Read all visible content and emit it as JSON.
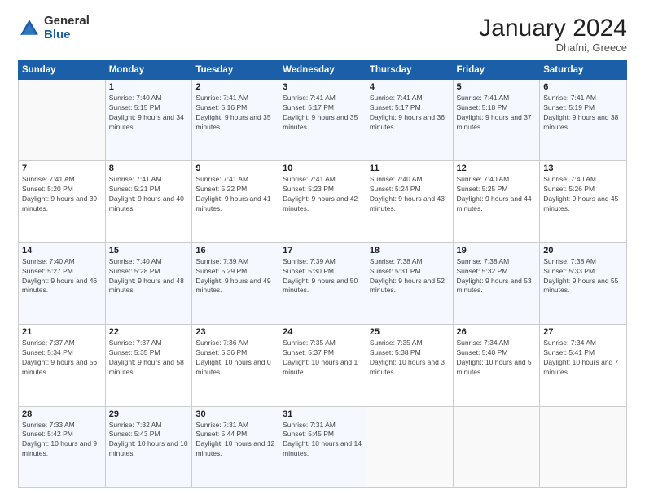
{
  "logo": {
    "general": "General",
    "blue": "Blue"
  },
  "header": {
    "month": "January 2024",
    "location": "Dhafni, Greece"
  },
  "weekdays": [
    "Sunday",
    "Monday",
    "Tuesday",
    "Wednesday",
    "Thursday",
    "Friday",
    "Saturday"
  ],
  "weeks": [
    [
      {
        "day": "",
        "sunrise": "",
        "sunset": "",
        "daylight": ""
      },
      {
        "day": "1",
        "sunrise": "7:40 AM",
        "sunset": "5:15 PM",
        "daylight": "9 hours and 34 minutes."
      },
      {
        "day": "2",
        "sunrise": "7:41 AM",
        "sunset": "5:16 PM",
        "daylight": "9 hours and 35 minutes."
      },
      {
        "day": "3",
        "sunrise": "7:41 AM",
        "sunset": "5:17 PM",
        "daylight": "9 hours and 35 minutes."
      },
      {
        "day": "4",
        "sunrise": "7:41 AM",
        "sunset": "5:17 PM",
        "daylight": "9 hours and 36 minutes."
      },
      {
        "day": "5",
        "sunrise": "7:41 AM",
        "sunset": "5:18 PM",
        "daylight": "9 hours and 37 minutes."
      },
      {
        "day": "6",
        "sunrise": "7:41 AM",
        "sunset": "5:19 PM",
        "daylight": "9 hours and 38 minutes."
      }
    ],
    [
      {
        "day": "7",
        "sunrise": "7:41 AM",
        "sunset": "5:20 PM",
        "daylight": "9 hours and 39 minutes."
      },
      {
        "day": "8",
        "sunrise": "7:41 AM",
        "sunset": "5:21 PM",
        "daylight": "9 hours and 40 minutes."
      },
      {
        "day": "9",
        "sunrise": "7:41 AM",
        "sunset": "5:22 PM",
        "daylight": "9 hours and 41 minutes."
      },
      {
        "day": "10",
        "sunrise": "7:41 AM",
        "sunset": "5:23 PM",
        "daylight": "9 hours and 42 minutes."
      },
      {
        "day": "11",
        "sunrise": "7:40 AM",
        "sunset": "5:24 PM",
        "daylight": "9 hours and 43 minutes."
      },
      {
        "day": "12",
        "sunrise": "7:40 AM",
        "sunset": "5:25 PM",
        "daylight": "9 hours and 44 minutes."
      },
      {
        "day": "13",
        "sunrise": "7:40 AM",
        "sunset": "5:26 PM",
        "daylight": "9 hours and 45 minutes."
      }
    ],
    [
      {
        "day": "14",
        "sunrise": "7:40 AM",
        "sunset": "5:27 PM",
        "daylight": "9 hours and 46 minutes."
      },
      {
        "day": "15",
        "sunrise": "7:40 AM",
        "sunset": "5:28 PM",
        "daylight": "9 hours and 48 minutes."
      },
      {
        "day": "16",
        "sunrise": "7:39 AM",
        "sunset": "5:29 PM",
        "daylight": "9 hours and 49 minutes."
      },
      {
        "day": "17",
        "sunrise": "7:39 AM",
        "sunset": "5:30 PM",
        "daylight": "9 hours and 50 minutes."
      },
      {
        "day": "18",
        "sunrise": "7:38 AM",
        "sunset": "5:31 PM",
        "daylight": "9 hours and 52 minutes."
      },
      {
        "day": "19",
        "sunrise": "7:38 AM",
        "sunset": "5:32 PM",
        "daylight": "9 hours and 53 minutes."
      },
      {
        "day": "20",
        "sunrise": "7:38 AM",
        "sunset": "5:33 PM",
        "daylight": "9 hours and 55 minutes."
      }
    ],
    [
      {
        "day": "21",
        "sunrise": "7:37 AM",
        "sunset": "5:34 PM",
        "daylight": "9 hours and 56 minutes."
      },
      {
        "day": "22",
        "sunrise": "7:37 AM",
        "sunset": "5:35 PM",
        "daylight": "9 hours and 58 minutes."
      },
      {
        "day": "23",
        "sunrise": "7:36 AM",
        "sunset": "5:36 PM",
        "daylight": "10 hours and 0 minutes."
      },
      {
        "day": "24",
        "sunrise": "7:35 AM",
        "sunset": "5:37 PM",
        "daylight": "10 hours and 1 minute."
      },
      {
        "day": "25",
        "sunrise": "7:35 AM",
        "sunset": "5:38 PM",
        "daylight": "10 hours and 3 minutes."
      },
      {
        "day": "26",
        "sunrise": "7:34 AM",
        "sunset": "5:40 PM",
        "daylight": "10 hours and 5 minutes."
      },
      {
        "day": "27",
        "sunrise": "7:34 AM",
        "sunset": "5:41 PM",
        "daylight": "10 hours and 7 minutes."
      }
    ],
    [
      {
        "day": "28",
        "sunrise": "7:33 AM",
        "sunset": "5:42 PM",
        "daylight": "10 hours and 9 minutes."
      },
      {
        "day": "29",
        "sunrise": "7:32 AM",
        "sunset": "5:43 PM",
        "daylight": "10 hours and 10 minutes."
      },
      {
        "day": "30",
        "sunrise": "7:31 AM",
        "sunset": "5:44 PM",
        "daylight": "10 hours and 12 minutes."
      },
      {
        "day": "31",
        "sunrise": "7:31 AM",
        "sunset": "5:45 PM",
        "daylight": "10 hours and 14 minutes."
      },
      {
        "day": "",
        "sunrise": "",
        "sunset": "",
        "daylight": ""
      },
      {
        "day": "",
        "sunrise": "",
        "sunset": "",
        "daylight": ""
      },
      {
        "day": "",
        "sunrise": "",
        "sunset": "",
        "daylight": ""
      }
    ]
  ],
  "labels": {
    "sunrise": "Sunrise:",
    "sunset": "Sunset:",
    "daylight": "Daylight:"
  }
}
